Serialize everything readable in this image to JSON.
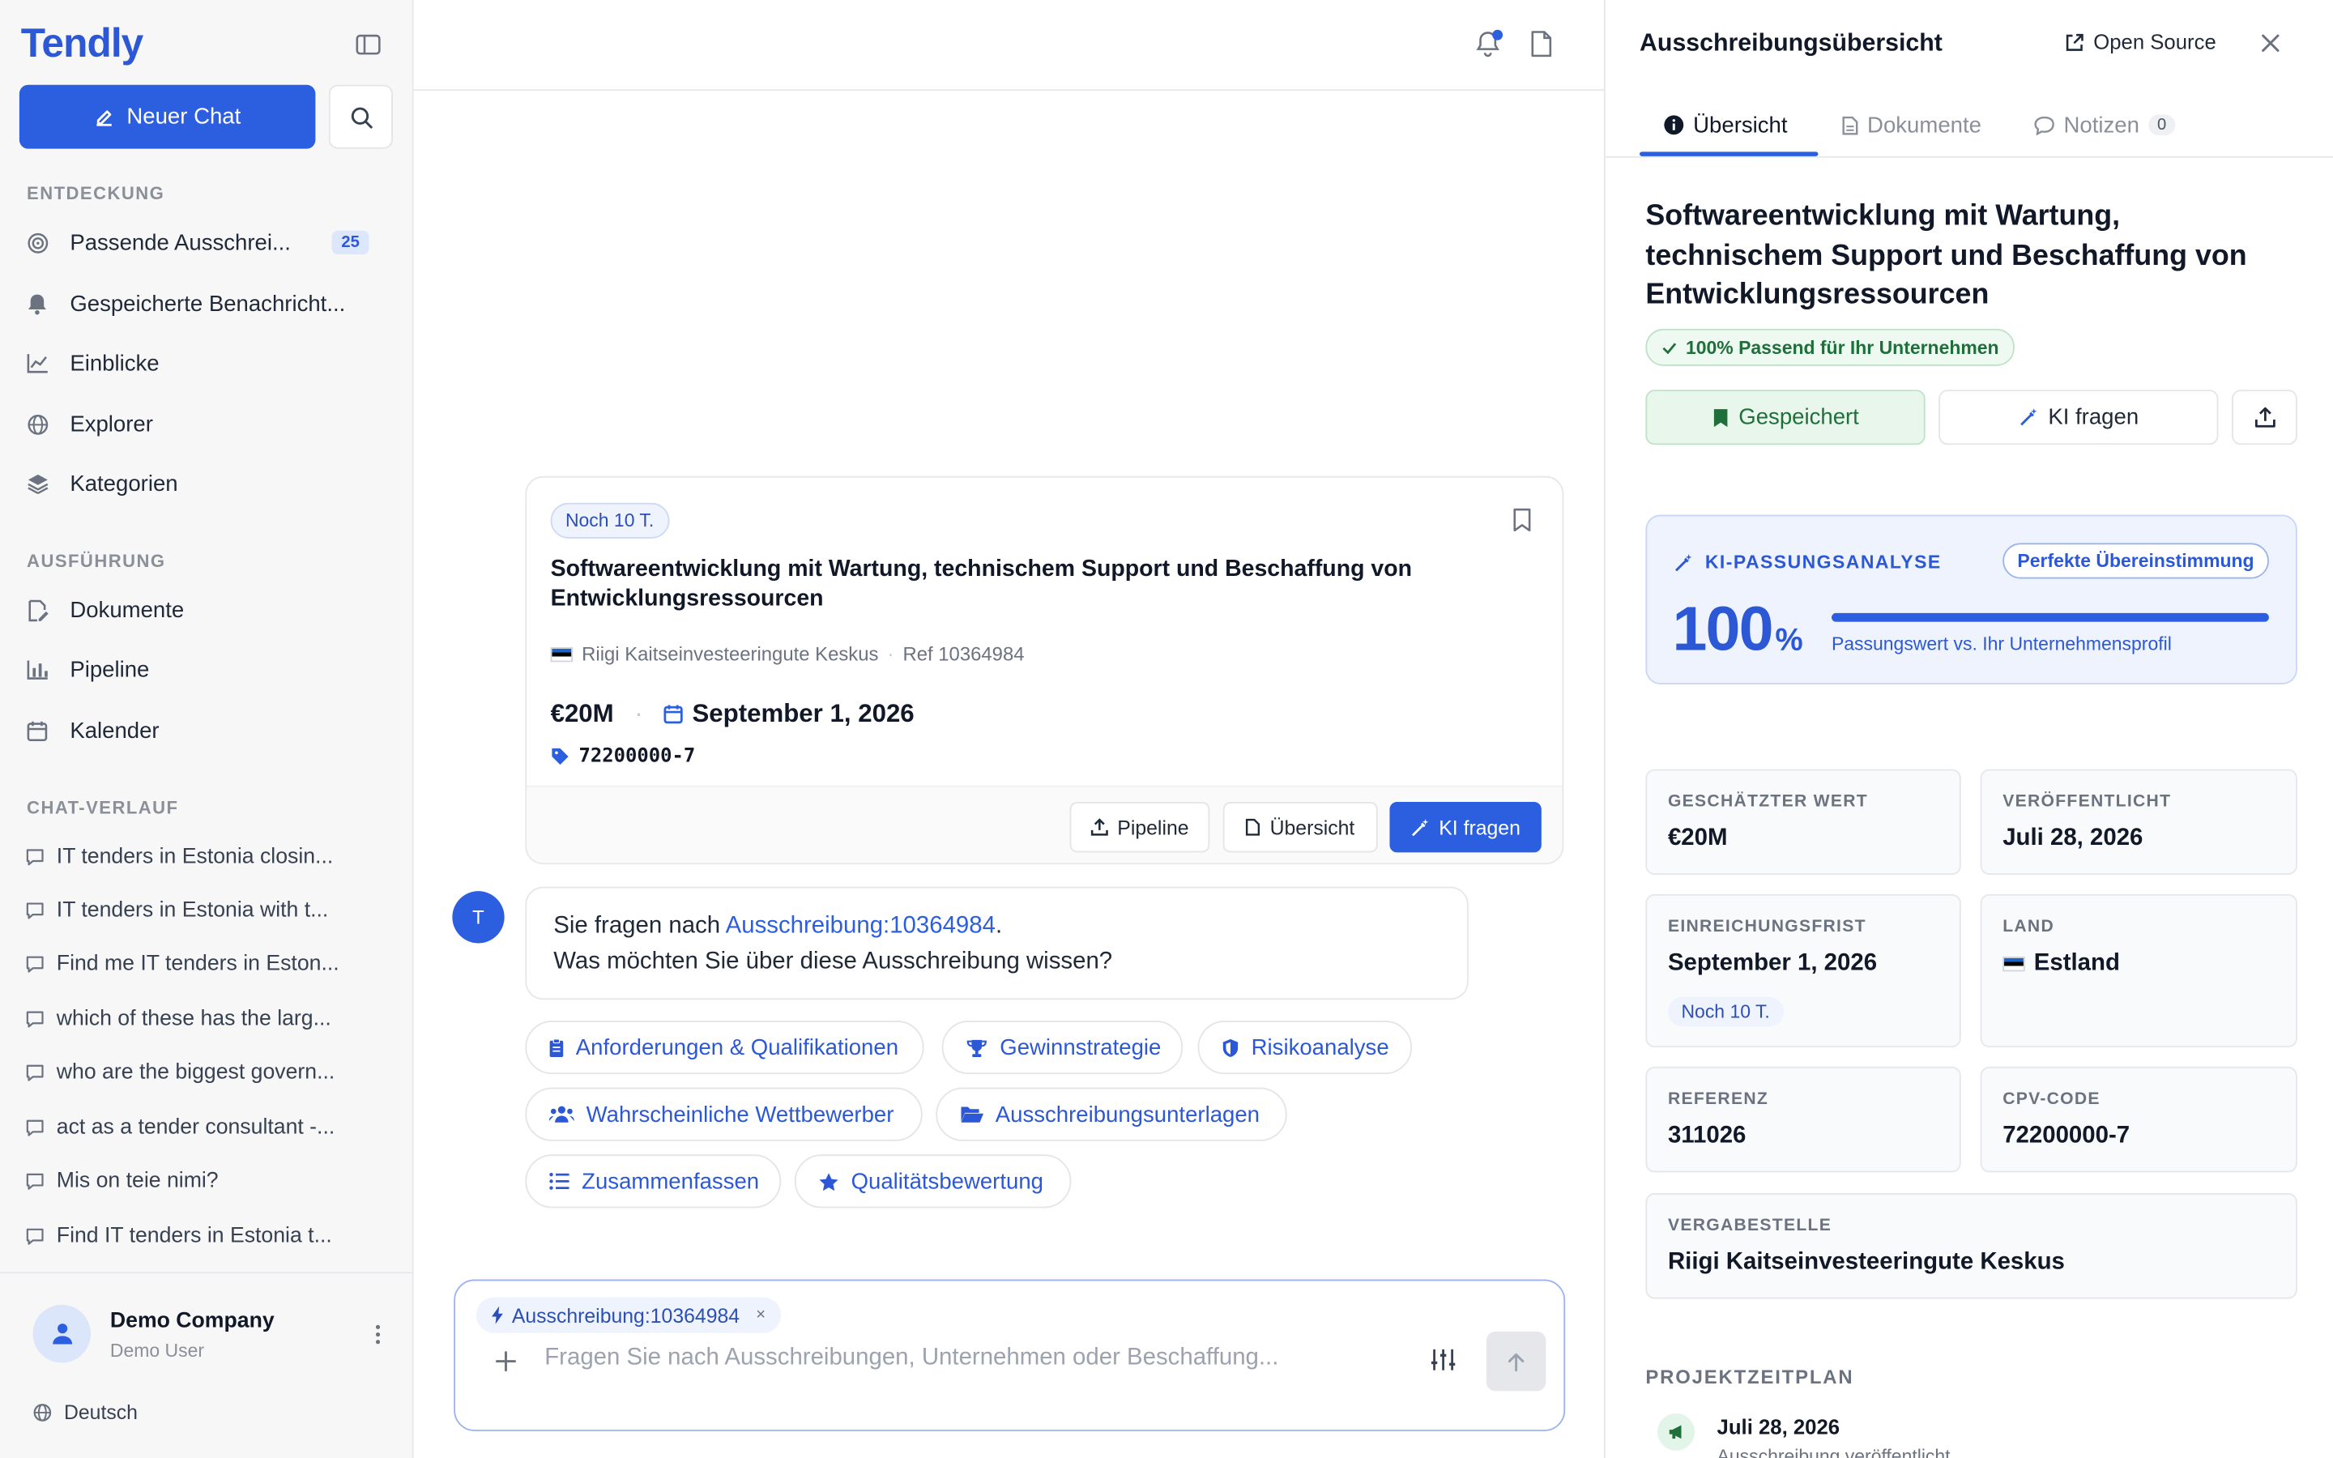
{
  "sidebar": {
    "brand": "Tendly",
    "new_chat_label": "Neuer Chat",
    "sections": {
      "discovery": "ENTDECKUNG",
      "execution": "AUSFÜHRUNG",
      "history": "CHAT-VERLAUF"
    },
    "discovery_items": [
      {
        "label": "Passende Ausschrei...",
        "icon": "target-icon",
        "count": "25"
      },
      {
        "label": "Gespeicherte Benachricht...",
        "icon": "bell-icon"
      },
      {
        "label": "Einblicke",
        "icon": "chart-line-icon"
      },
      {
        "label": "Explorer",
        "icon": "globe-icon"
      },
      {
        "label": "Kategorien",
        "icon": "layers-icon"
      }
    ],
    "execution_items": [
      {
        "label": "Dokumente",
        "icon": "file-edit-icon"
      },
      {
        "label": "Pipeline",
        "icon": "bar-chart-icon"
      },
      {
        "label": "Kalender",
        "icon": "calendar-icon"
      }
    ],
    "history_items": [
      "IT tenders in Estonia closin...",
      "IT tenders in Estonia with t...",
      "Find me IT tenders in Eston...",
      "which of these has the larg...",
      "who are the biggest govern...",
      "act as a tender consultant -...",
      "Mis on teie nimi?",
      "Find IT tenders in Estonia t..."
    ],
    "footer": {
      "company": "Demo Company",
      "user": "Demo User",
      "language": "Deutsch"
    }
  },
  "main": {
    "card": {
      "deadline_pill": "Noch 10 T.",
      "title": "Softwareentwicklung mit Wartung, technischem Support und Beschaffung von Entwicklungsressourcen",
      "buyer": "Riigi Kaitseinvesteeringute Keskus",
      "ref": "Ref 10364984",
      "value": "€20M",
      "deadline": "September 1, 2026",
      "cpv": "72200000-7",
      "actions": {
        "pipeline": "Pipeline",
        "overview": "Übersicht",
        "ask_ai": "KI fragen"
      }
    },
    "message": {
      "avatar_initial": "T",
      "prefix": "Sie fragen nach ",
      "link": "Ausschreibung:10364984",
      "suffix": ".",
      "line2": "Was möchten Sie über diese Ausschreibung wissen?"
    },
    "chips": [
      {
        "label": "Anforderungen & Qualifikationen",
        "icon": "clipboard-icon"
      },
      {
        "label": "Gewinnstrategie",
        "icon": "trophy-icon"
      },
      {
        "label": "Risikoanalyse",
        "icon": "shield-icon"
      },
      {
        "label": "Wahrscheinliche Wettbewerber",
        "icon": "users-icon"
      },
      {
        "label": "Ausschreibungsunterlagen",
        "icon": "folder-open-icon"
      },
      {
        "label": "Zusammenfassen",
        "icon": "list-icon"
      },
      {
        "label": "Qualitätsbewertung",
        "icon": "star-icon"
      }
    ],
    "composer": {
      "context_tag": "Ausschreibung:10364984",
      "context_remove": "×",
      "placeholder": "Fragen Sie nach Ausschreibungen, Unternehmen oder Beschaffung..."
    }
  },
  "panel": {
    "title": "Ausschreibungsübersicht",
    "open_source": "Open Source",
    "tabs": {
      "overview": "Übersicht",
      "documents": "Dokumente",
      "notes": "Notizen",
      "notes_count": "0"
    },
    "tender_title": "Softwareentwicklung mit Wartung, technischem Support und Beschaffung von Entwicklungsressourcen",
    "match_pill": "100% Passend für Ihr Unternehmen",
    "buttons": {
      "saved": "Gespeichert",
      "ask_ai": "KI fragen"
    },
    "analysis": {
      "label": "KI-PASSUNGSANALYSE",
      "badge": "Perfekte Übereinstimmung",
      "score": "100",
      "score_unit": "%",
      "score_fraction": 1.0,
      "caption": "Passungswert vs. Ihr Unternehmensprofil"
    },
    "facts": {
      "est_value_label": "GESCHÄTZTER WERT",
      "est_value": "€20M",
      "published_label": "VERÖFFENTLICHT",
      "published": "Juli 28, 2026",
      "deadline_label": "EINREICHUNGSFRIST",
      "deadline": "September 1, 2026",
      "deadline_pill": "Noch 10 T.",
      "country_label": "LAND",
      "country": "Estland",
      "reference_label": "REFERENZ",
      "reference": "311026",
      "cpv_label": "CPV-CODE",
      "cpv": "72200000-7",
      "buyer_label": "VERGABESTELLE",
      "buyer": "Riigi Kaitseinvesteeringute Keskus"
    },
    "timeline": {
      "label": "PROJEKTZEITPLAN",
      "date": "Juli 28, 2026",
      "desc": "Ausschreibung veröffentlicht"
    }
  },
  "colors": {
    "accent": "#2c5fe0",
    "brand": "#2c58d6",
    "success": "#1f6f3a"
  }
}
